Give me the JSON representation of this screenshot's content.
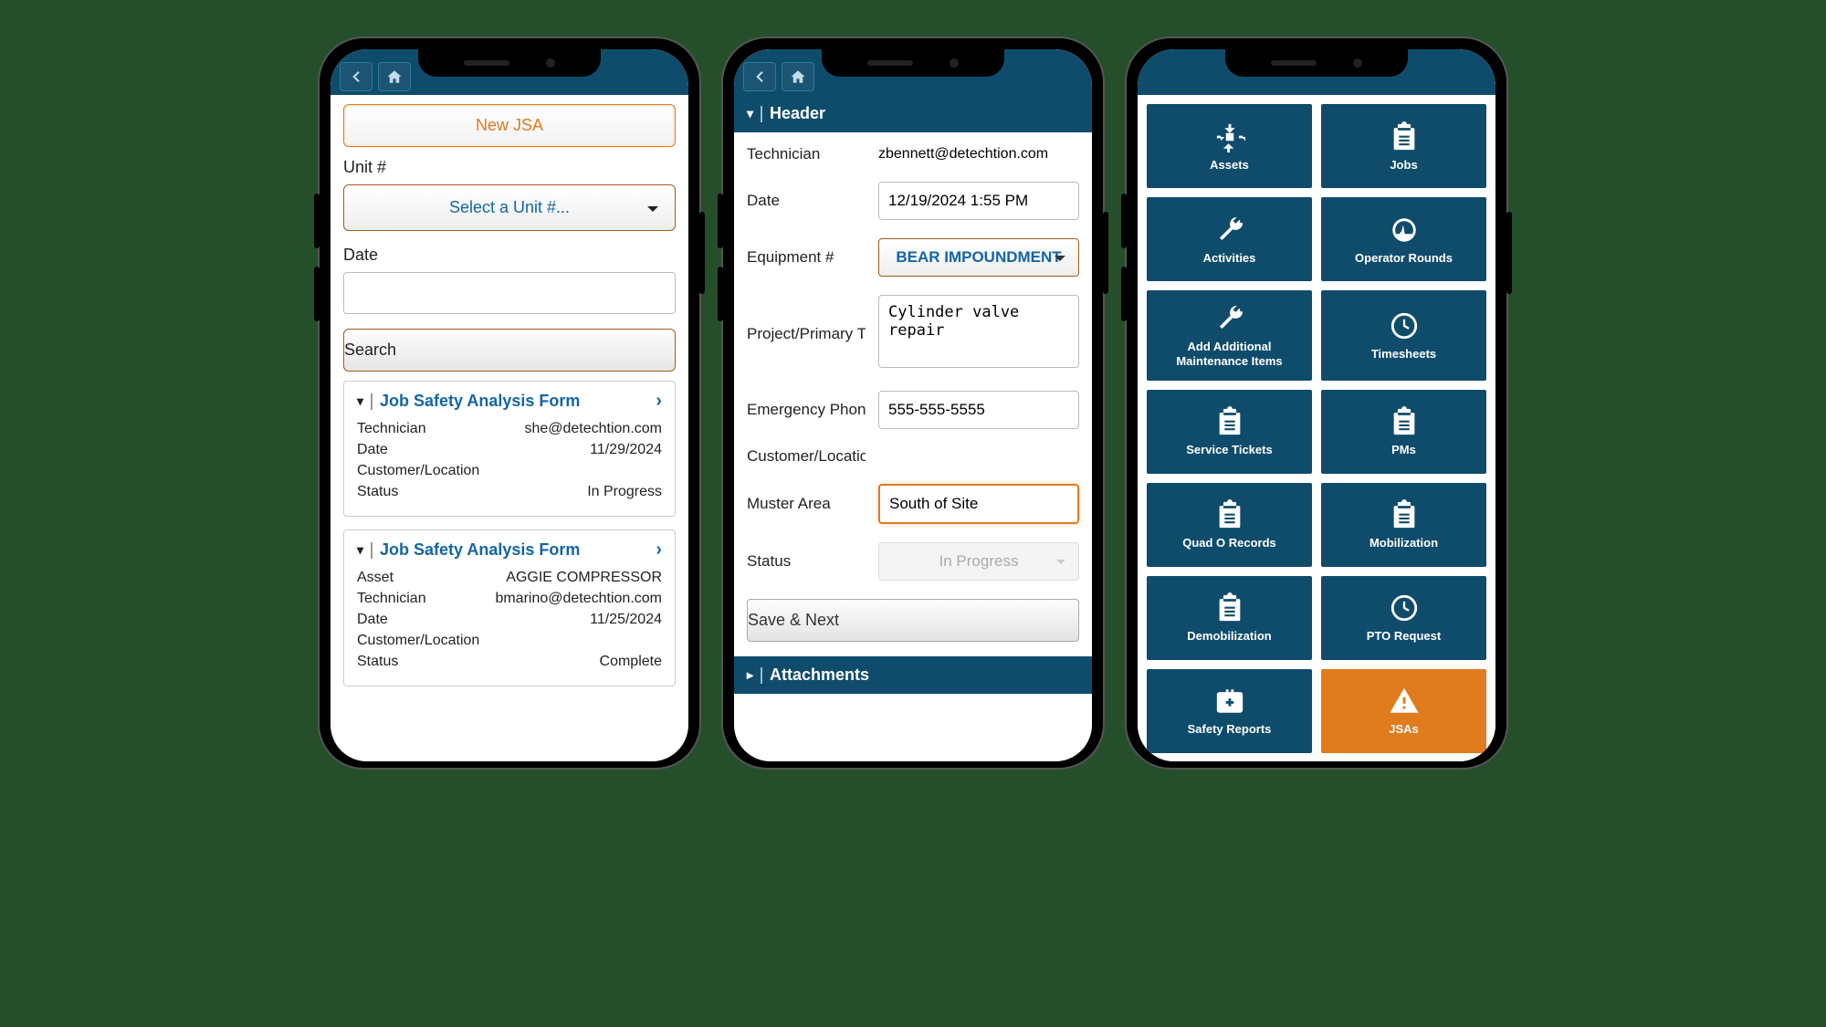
{
  "screen1": {
    "new_jsa_btn": "New JSA",
    "unit_label": "Unit #",
    "unit_placeholder": "Select a Unit #...",
    "date_label": "Date",
    "search_btn": "Search",
    "cards": [
      {
        "title": "Job Safety Analysis Form",
        "rows": {
          "technician_label": "Technician",
          "technician_value": "she@detechtion.com",
          "date_label": "Date",
          "date_value": "11/29/2024",
          "custloc_label": "Customer/Location",
          "custloc_value": "",
          "status_label": "Status",
          "status_value": "In Progress"
        }
      },
      {
        "title": "Job Safety Analysis Form",
        "rows": {
          "asset_label": "Asset",
          "asset_value": "AGGIE COMPRESSOR",
          "technician_label": "Technician",
          "technician_value": "bmarino@detechtion.com",
          "date_label": "Date",
          "date_value": "11/25/2024",
          "custloc_label": "Customer/Location",
          "custloc_value": "",
          "status_label": "Status",
          "status_value": "Complete"
        }
      }
    ]
  },
  "screen2": {
    "header_title": "Header",
    "technician_label": "Technician",
    "technician_value": "zbennett@detechtion.com",
    "date_label": "Date",
    "date_value": "12/19/2024 1:55 PM",
    "equipment_label": "Equipment #",
    "equipment_value": "BEAR IMPOUNDMENT",
    "project_label": "Project/Primary Ta",
    "project_value": "Cylinder valve repair",
    "emergency_label": "Emergency Phone",
    "emergency_value": "555-555-5555",
    "custloc_label": "Customer/Locatio",
    "muster_label": "Muster Area",
    "muster_value": "South of Site",
    "status_label": "Status",
    "status_value": "In Progress",
    "save_next_btn": "Save & Next",
    "attachments_title": "Attachments"
  },
  "screen3": {
    "tiles": [
      {
        "label": "Assets",
        "icon": "assets"
      },
      {
        "label": "Jobs",
        "icon": "clipboard"
      },
      {
        "label": "Activities",
        "icon": "wrench"
      },
      {
        "label": "Operator Rounds",
        "icon": "gauge"
      },
      {
        "label": "Add Additional Maintenance Items",
        "icon": "wrench"
      },
      {
        "label": "Timesheets",
        "icon": "clock"
      },
      {
        "label": "Service Tickets",
        "icon": "clipboard"
      },
      {
        "label": "PMs",
        "icon": "clipboard"
      },
      {
        "label": "Quad O Records",
        "icon": "clipboard"
      },
      {
        "label": "Mobilization",
        "icon": "clipboard"
      },
      {
        "label": "Demobilization",
        "icon": "clipboard"
      },
      {
        "label": "PTO Request",
        "icon": "clock"
      },
      {
        "label": "Safety Reports",
        "icon": "medkit"
      },
      {
        "label": "JSAs",
        "icon": "warning",
        "active": true
      }
    ]
  }
}
